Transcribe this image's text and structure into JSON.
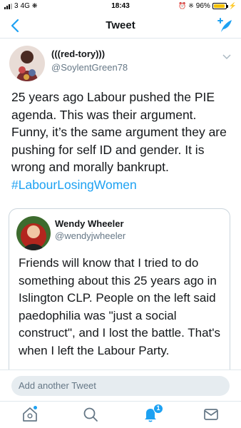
{
  "status_bar": {
    "carrier": "3",
    "network": "4G",
    "time": "18:43",
    "battery": "96%",
    "battery_level": 0.96
  },
  "nav": {
    "title": "Tweet",
    "back_icon": "chevron-left-icon",
    "compose_icon": "compose-tweet-icon"
  },
  "tweet": {
    "display_name": "(((red-tory)))",
    "handle": "@SoylentGreen78",
    "text": "25 years ago Labour pushed the PIE agenda. This was their argument. Funny, it’s the same argument they are pushing for self ID and gender. It is wrong and morally bankrupt.",
    "hashtag": "#LabourLosingWomen"
  },
  "quoted_tweet": {
    "display_name": "Wendy Wheeler",
    "handle": "@wendyjwheeler",
    "text": "Friends will know that I tried to do something about this 25 years ago in Islington CLP. People on the left said paedophilia was \"just a social construct\", and I lost the battle. That's when I left the Labour Party."
  },
  "reply": {
    "placeholder": "Add another Tweet"
  },
  "tab_bar": {
    "notification_count": "1"
  },
  "colors": {
    "accent": "#1da1f2",
    "text": "#14171a",
    "secondary": "#657786"
  }
}
